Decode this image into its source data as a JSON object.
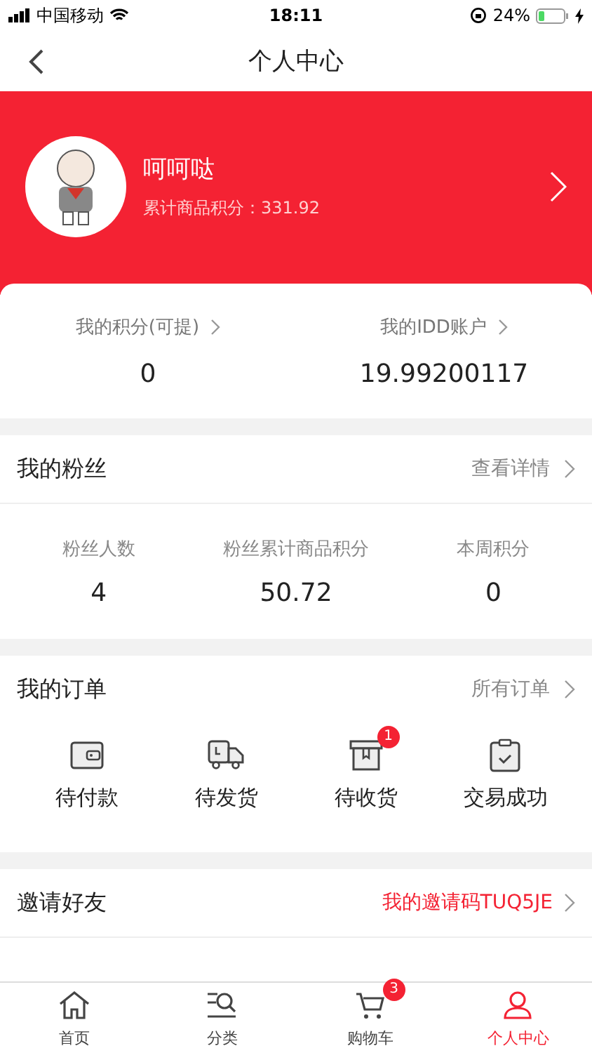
{
  "status_bar": {
    "carrier": "中国移动",
    "time": "18:11",
    "battery": "24%"
  },
  "nav": {
    "title": "个人中心"
  },
  "profile": {
    "name": "呵呵哒",
    "points_label": "累计商品积分：331.92"
  },
  "accounts": [
    {
      "label": "我的积分(可提)",
      "value": "0"
    },
    {
      "label": "我的IDD账户",
      "value": "19.99200117"
    }
  ],
  "fans": {
    "title": "我的粉丝",
    "link": "查看详情",
    "stats": [
      {
        "label": "粉丝人数",
        "value": "4"
      },
      {
        "label": "粉丝累计商品积分",
        "value": "50.72"
      },
      {
        "label": "本周积分",
        "value": "0"
      }
    ]
  },
  "orders": {
    "title": "我的订单",
    "link": "所有订单",
    "items": [
      {
        "kind": "wallet",
        "label": "待付款"
      },
      {
        "kind": "truck",
        "label": "待发货"
      },
      {
        "kind": "box",
        "label": "待收货",
        "badge": "1"
      },
      {
        "kind": "clipboard",
        "label": "交易成功"
      }
    ]
  },
  "invite": {
    "title": "邀请好友",
    "code": "我的邀请码TUQ5JE"
  },
  "tab_bar": [
    {
      "kind": "home",
      "label": "首页",
      "selected": false
    },
    {
      "kind": "category",
      "label": "分类",
      "selected": false
    },
    {
      "kind": "cart",
      "label": "购物车",
      "selected": false,
      "badge": "3"
    },
    {
      "kind": "user",
      "label": "个人中心",
      "selected": true
    }
  ]
}
